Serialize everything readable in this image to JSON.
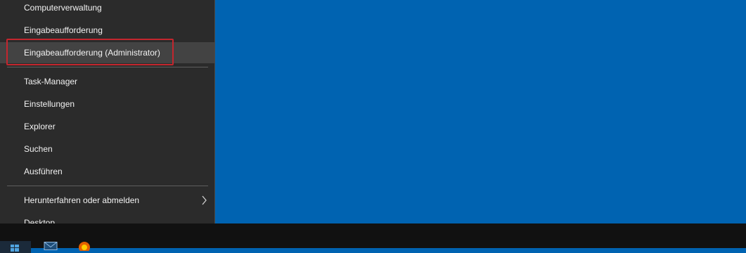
{
  "menu": {
    "items": [
      {
        "label": "Computerverwaltung"
      },
      {
        "label": "Eingabeaufforderung"
      },
      {
        "label": "Eingabeaufforderung (Administrator)"
      },
      {
        "label": "Task-Manager"
      },
      {
        "label": "Einstellungen"
      },
      {
        "label": "Explorer"
      },
      {
        "label": "Suchen"
      },
      {
        "label": "Ausführen"
      },
      {
        "label": "Herunterfahren oder abmelden"
      },
      {
        "label": "Desktop"
      }
    ],
    "submenu_icon": "chevron-right-icon"
  },
  "taskbar": {
    "icons": [
      "windows-start-icon",
      "mail-icon",
      "firefox-icon"
    ]
  },
  "colors": {
    "desktop": "#0063b1",
    "menu_bg": "#2b2b2b",
    "hover": "#434343",
    "highlight": "#c4262e",
    "taskbar": "#111111"
  }
}
